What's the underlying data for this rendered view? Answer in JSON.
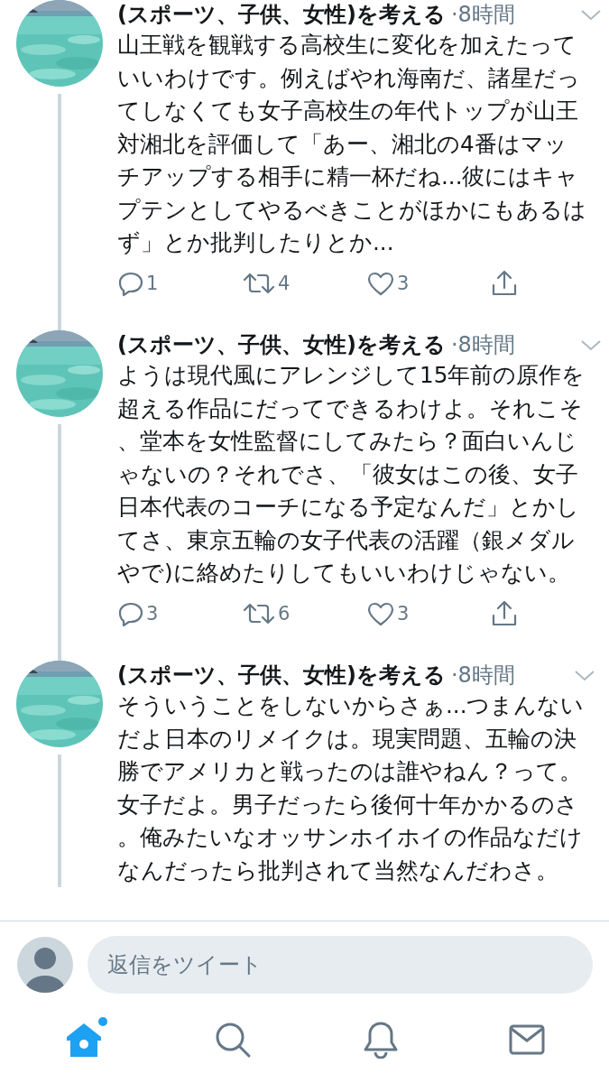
{
  "tweets": [
    {
      "author": "(スポーツ、子供、女性)を考える",
      "time": "·8時間",
      "text": "山王戦を観戦する高校生に変化を加えたっていいわけです。例えばやれ海南だ、諸星だってしなくても女子高校生の年代トップが山王対湘北を評価して「あー、湘北の4番はマッチアップする相手に精一杯だね...彼にはキャプテンとしてやるべきことがほかにもあるはず」とか批判したりとか...",
      "replies": "1",
      "retweets": "4",
      "likes": "3"
    },
    {
      "author": "(スポーツ、子供、女性)を考える",
      "time": "·8時間",
      "text": "ようは現代風にアレンジして15年前の原作を超える作品にだってできるわけよ。それこそ、堂本を女性監督にしてみたら？面白いんじゃないの？それでさ、「彼女はこの後、女子日本代表のコーチになる予定なんだ」とかしてさ、東京五輪の女子代表の活躍（銀メダルやで)に絡めたりしてもいいわけじゃない。",
      "replies": "3",
      "retweets": "6",
      "likes": "3"
    },
    {
      "author": "(スポーツ、子供、女性)を考える",
      "time": "·8時間",
      "text": "そういうことをしないからさぁ...つまんないだよ日本のリメイクは。現実問題、五輪の決勝でアメリカと戦ったのは誰やねん？って。女子だよ。男子だったら後何十年かかるのさ。俺みたいなオッサンホイホイの作品なだけなんだったら批判されて当然なんだわさ。"
    }
  ],
  "reply_box": {
    "placeholder": "返信をツイート"
  },
  "nav": [
    {
      "kind": "home",
      "selected": true,
      "badge": true
    },
    {
      "kind": "search",
      "selected": false
    },
    {
      "kind": "notifications",
      "selected": false
    },
    {
      "kind": "messages",
      "selected": false
    }
  ]
}
